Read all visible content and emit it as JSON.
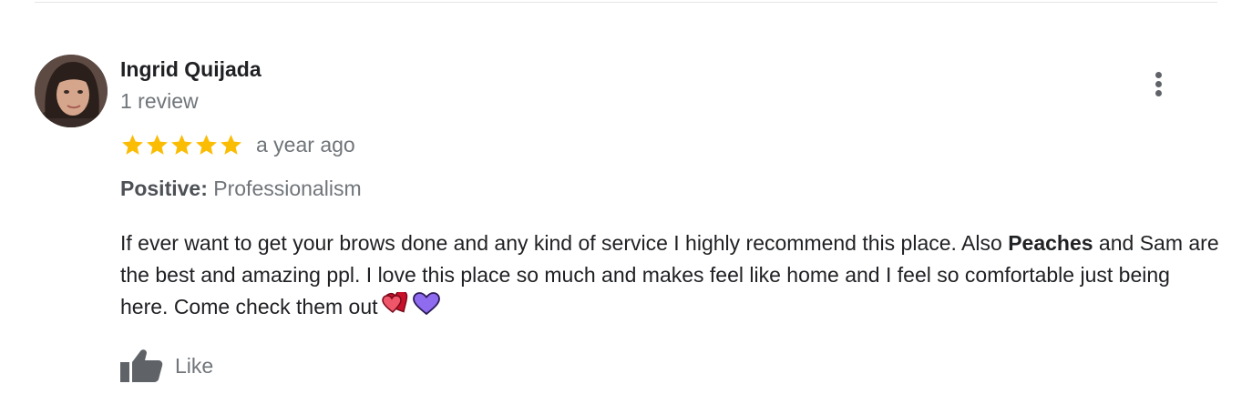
{
  "review": {
    "author_name": "Ingrid Quijada",
    "review_count": "1 review",
    "rating": 5,
    "rating_max": 5,
    "time_ago": "a year ago",
    "positive_label": "Positive:",
    "positive_value": "Professionalism",
    "text_part1": "If ever want to get your brows done and any kind of service I highly recommend this place. Also ",
    "text_bold": "Peaches",
    "text_part2": " and Sam are the best and amazing ppl. I love this place so much and makes feel like home and I feel so comfortable just being here. Come check them out",
    "emojis": [
      "two-hearts-icon",
      "purple-heart-icon"
    ],
    "like_label": "Like"
  },
  "colors": {
    "star": "#fbbc04",
    "secondary_text": "#70757a",
    "primary_text": "#202124"
  }
}
